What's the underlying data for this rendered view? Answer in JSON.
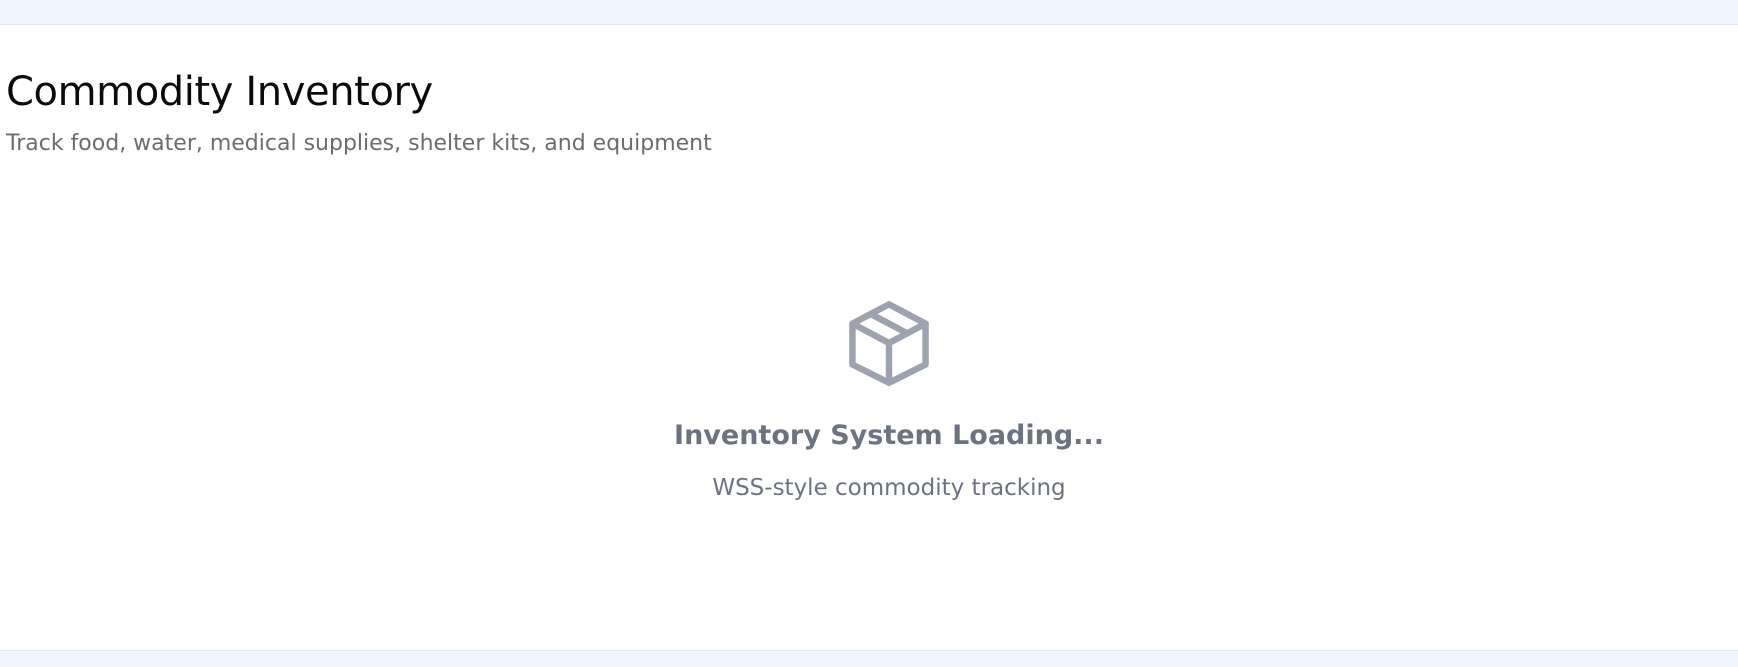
{
  "header": {
    "title": "Commodity Inventory",
    "subtitle": "Track food, water, medical supplies, shelter kits, and equipment"
  },
  "empty_state": {
    "icon": "package-box-icon",
    "title": "Inventory System Loading...",
    "subtitle": "WSS-style commodity tracking"
  },
  "colors": {
    "page_background": "#f1f5fd",
    "panel_background": "#ffffff",
    "title_text": "#0b0b0f",
    "muted_text": "#6b7280",
    "icon": "#9ca3af"
  }
}
